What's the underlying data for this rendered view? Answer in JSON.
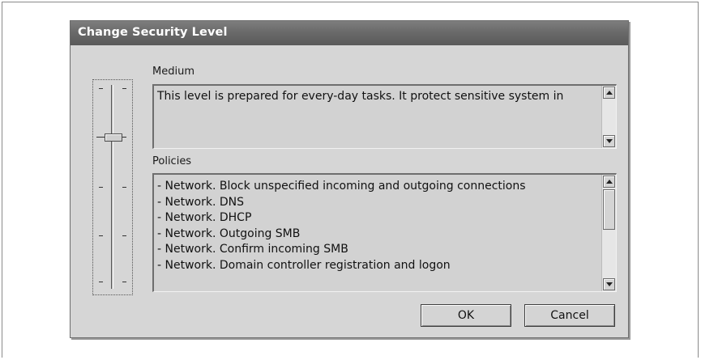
{
  "dialog": {
    "title": "Change Security Level"
  },
  "security_level": {
    "current_label": "Medium",
    "description": "This level is prepared for every-day tasks. It protect sensitive system in",
    "slider_level_index": 1,
    "slider_level_count": 5
  },
  "policies": {
    "label": "Policies",
    "items": [
      "- Network. Block unspecified incoming and outgoing connections",
      "- Network. DNS",
      "- Network. DHCP",
      "- Network. Outgoing SMB",
      "- Network. Confirm incoming SMB",
      "- Network. Domain controller registration and logon"
    ]
  },
  "buttons": {
    "ok_label": "OK",
    "cancel_label": "Cancel"
  }
}
